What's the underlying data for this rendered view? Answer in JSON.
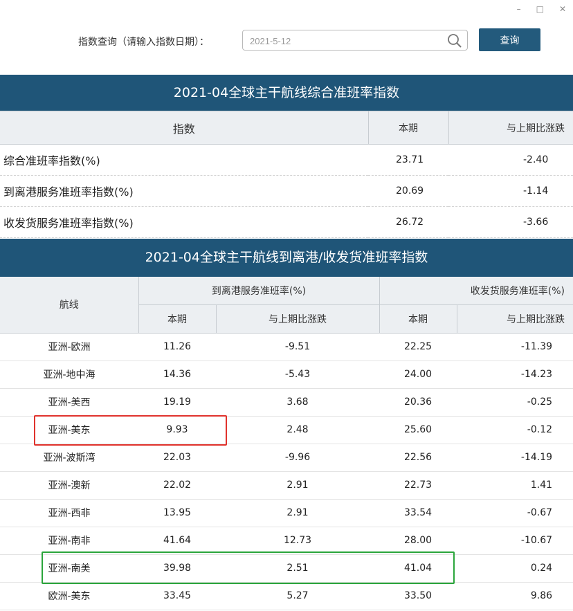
{
  "window": {
    "minimize": "–",
    "maximize": "□",
    "close": "✕"
  },
  "query": {
    "label": "指数查询（请输入指数日期）：",
    "date_value": "2021-5-12",
    "button_label": "查询"
  },
  "table1": {
    "title": "2021-04全球主干航线综合准班率指数",
    "headers": [
      "指数",
      "本期",
      "与上期比涨跌"
    ],
    "rows": [
      {
        "name": "综合准班率指数(%)",
        "current": "23.71",
        "change": "-2.40"
      },
      {
        "name": "到离港服务准班率指数(%)",
        "current": "20.69",
        "change": "-1.14"
      },
      {
        "name": "收发货服务准班率指数(%)",
        "current": "26.72",
        "change": "-3.66"
      }
    ]
  },
  "table2": {
    "title": "2021-04全球主干航线到离港/收发货准班率指数",
    "route_header": "航线",
    "group1": "到离港服务准班率(%)",
    "group2": "收发货服务准班率(%)",
    "sub_current": "本期",
    "sub_change": "与上期比涨跌",
    "rows": [
      {
        "route": "亚洲-欧洲",
        "a_cur": "11.26",
        "a_chg": "-9.51",
        "b_cur": "22.25",
        "b_chg": "-11.39"
      },
      {
        "route": "亚洲-地中海",
        "a_cur": "14.36",
        "a_chg": "-5.43",
        "b_cur": "24.00",
        "b_chg": "-14.23"
      },
      {
        "route": "亚洲-美西",
        "a_cur": "19.19",
        "a_chg": "3.68",
        "b_cur": "20.36",
        "b_chg": "-0.25"
      },
      {
        "route": "亚洲-美东",
        "a_cur": "9.93",
        "a_chg": "2.48",
        "b_cur": "25.60",
        "b_chg": "-0.12"
      },
      {
        "route": "亚洲-波斯湾",
        "a_cur": "22.03",
        "a_chg": "-9.96",
        "b_cur": "22.56",
        "b_chg": "-14.19"
      },
      {
        "route": "亚洲-澳新",
        "a_cur": "22.02",
        "a_chg": "2.91",
        "b_cur": "22.73",
        "b_chg": "1.41"
      },
      {
        "route": "亚洲-西非",
        "a_cur": "13.95",
        "a_chg": "2.91",
        "b_cur": "33.54",
        "b_chg": "-0.67"
      },
      {
        "route": "亚洲-南非",
        "a_cur": "41.64",
        "a_chg": "12.73",
        "b_cur": "28.00",
        "b_chg": "-10.67"
      },
      {
        "route": "亚洲-南美",
        "a_cur": "39.98",
        "a_chg": "2.51",
        "b_cur": "41.04",
        "b_chg": "0.24"
      },
      {
        "route": "欧洲-美东",
        "a_cur": "33.45",
        "a_chg": "5.27",
        "b_cur": "33.50",
        "b_chg": "9.86"
      }
    ]
  },
  "colors": {
    "header_blue": "#1f5578",
    "button_blue": "#235a7c",
    "highlight_red": "#e0322c",
    "highlight_green": "#2aa53b"
  }
}
